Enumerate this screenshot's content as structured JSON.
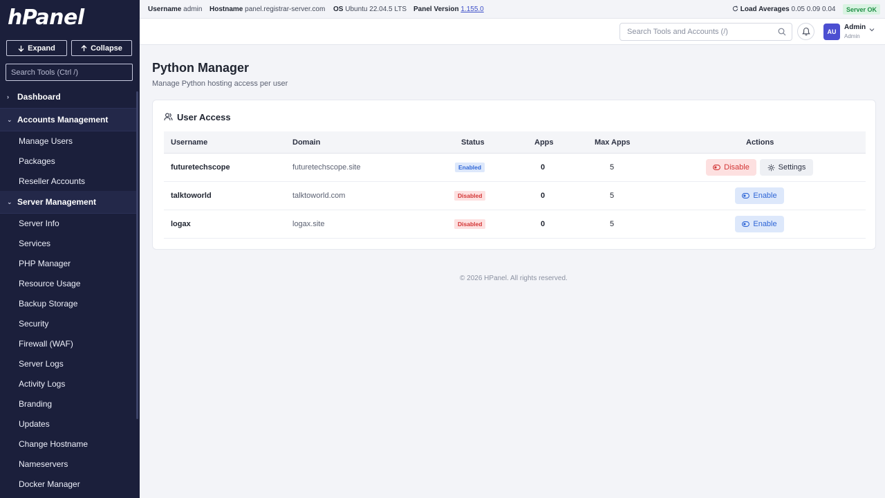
{
  "sidebar": {
    "logo": "hPanel",
    "expand_label": "Expand",
    "collapse_label": "Collapse",
    "search_placeholder": "Search Tools (Ctrl /)",
    "sections": [
      {
        "label": "Dashboard"
      },
      {
        "label": "Accounts Management"
      },
      {
        "label": "Server Management"
      }
    ],
    "accounts_items": [
      "Manage Users",
      "Packages",
      "Reseller Accounts"
    ],
    "server_items": [
      "Server Info",
      "Services",
      "PHP Manager",
      "Resource Usage",
      "Backup Storage",
      "Security",
      "Firewall (WAF)",
      "Server Logs",
      "Activity Logs",
      "Branding",
      "Updates",
      "Change Hostname",
      "Nameservers",
      "Docker Manager"
    ]
  },
  "topbar": {
    "username_label": "Username",
    "username_value": "admin",
    "hostname_label": "Hostname",
    "hostname_value": "panel.registrar-server.com",
    "os_label": "OS",
    "os_value": "Ubuntu 22.04.5 LTS",
    "panel_version_label": "Panel Version",
    "panel_version_value": "1.155.0",
    "load_label": "Load Averages",
    "load_value": "0.05 0.09 0.04",
    "status": "Server OK"
  },
  "header": {
    "search_placeholder": "Search Tools and Accounts (/)",
    "avatar_initials": "AU",
    "user_name": "Admin",
    "user_role": "Admin"
  },
  "page": {
    "title": "Python Manager",
    "subtitle": "Manage Python hosting access per user"
  },
  "card": {
    "title": "User Access",
    "columns": [
      "Username",
      "Domain",
      "Status",
      "Apps",
      "Max Apps",
      "Actions"
    ],
    "rows": [
      {
        "username": "futuretechscope",
        "domain": "futuretechscope.site",
        "status": "Enabled",
        "apps": "0",
        "max_apps": "5",
        "actions": [
          "Disable",
          "Settings"
        ]
      },
      {
        "username": "talktoworld",
        "domain": "talktoworld.com",
        "status": "Disabled",
        "apps": "0",
        "max_apps": "5",
        "actions": [
          "Enable"
        ]
      },
      {
        "username": "logax",
        "domain": "logax.site",
        "status": "Disabled",
        "apps": "0",
        "max_apps": "5",
        "actions": [
          "Enable"
        ]
      }
    ]
  },
  "footer": {
    "text": "© 2026 HPanel. All rights reserved."
  },
  "colors": {
    "sidebar_bg": "#1b1f3b",
    "accent": "#4c4fd1",
    "enabled": "#2f66d6",
    "disabled": "#d33535",
    "server_ok": "#1f8f45"
  }
}
